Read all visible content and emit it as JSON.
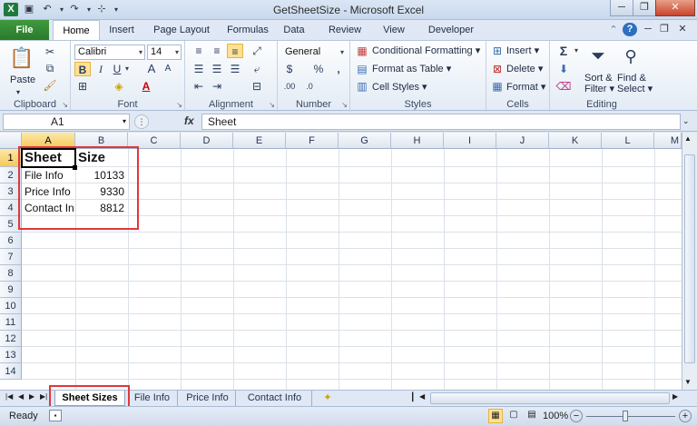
{
  "window": {
    "title": "GetSheetSize  -  Microsoft Excel",
    "minimize": "─",
    "restore": "❐",
    "close": "✕"
  },
  "qat": {
    "excel_icon": "x-icon",
    "save_icon": "save-icon",
    "undo_icon": "undo-icon",
    "redo_icon": "redo-icon",
    "customize": "▾"
  },
  "tabs": {
    "file": "File",
    "items": [
      "Home",
      "Insert",
      "Page Layout",
      "Formulas",
      "Data",
      "Review",
      "View",
      "Developer"
    ]
  },
  "ribbon": {
    "clipboard": {
      "label": "Clipboard",
      "paste": "Paste"
    },
    "font": {
      "label": "Font",
      "name": "Calibri",
      "size": "14",
      "bold": "B",
      "italic": "I",
      "underline": "U",
      "grow": "A",
      "shrink": "A"
    },
    "alignment": {
      "label": "Alignment"
    },
    "number": {
      "label": "Number",
      "format": "General",
      "currency": "$",
      "percent": "%",
      "comma": ","
    },
    "styles": {
      "label": "Styles",
      "conditional": "Conditional Formatting",
      "format_table": "Format as Table",
      "cell_styles": "Cell Styles"
    },
    "cells": {
      "label": "Cells",
      "insert": "Insert",
      "delete": "Delete",
      "format": "Format"
    },
    "editing": {
      "label": "Editing",
      "sum": "Σ",
      "sort_filter": [
        "Sort &",
        "Filter"
      ],
      "find_select": [
        "Find &",
        "Select"
      ]
    }
  },
  "formula_bar": {
    "name_box": "A1",
    "fx": "fx",
    "content": "Sheet"
  },
  "grid": {
    "columns": [
      "A",
      "B",
      "C",
      "D",
      "E",
      "F",
      "G",
      "H",
      "I",
      "J",
      "K",
      "L",
      "M"
    ],
    "rows": [
      "1",
      "2",
      "3",
      "4",
      "5",
      "6",
      "7",
      "8",
      "9",
      "10",
      "11",
      "12",
      "13",
      "14"
    ],
    "header": [
      "Sheet",
      "Size"
    ],
    "data": [
      [
        "File Info",
        "10133"
      ],
      [
        "Price Info",
        "9330"
      ],
      [
        "Contact In",
        "8812"
      ]
    ]
  },
  "sheets": {
    "tabs": [
      "Sheet Sizes",
      "File Info",
      "Price Info",
      "Contact Info"
    ],
    "active": "Sheet Sizes"
  },
  "status": {
    "ready": "Ready",
    "zoom": "100%",
    "zoom_minus": "−",
    "zoom_plus": "+"
  },
  "colors": {
    "accent_red": "#e0373b",
    "file_green": "#2a7a2a",
    "selection_yellow": "#f6c85a"
  }
}
